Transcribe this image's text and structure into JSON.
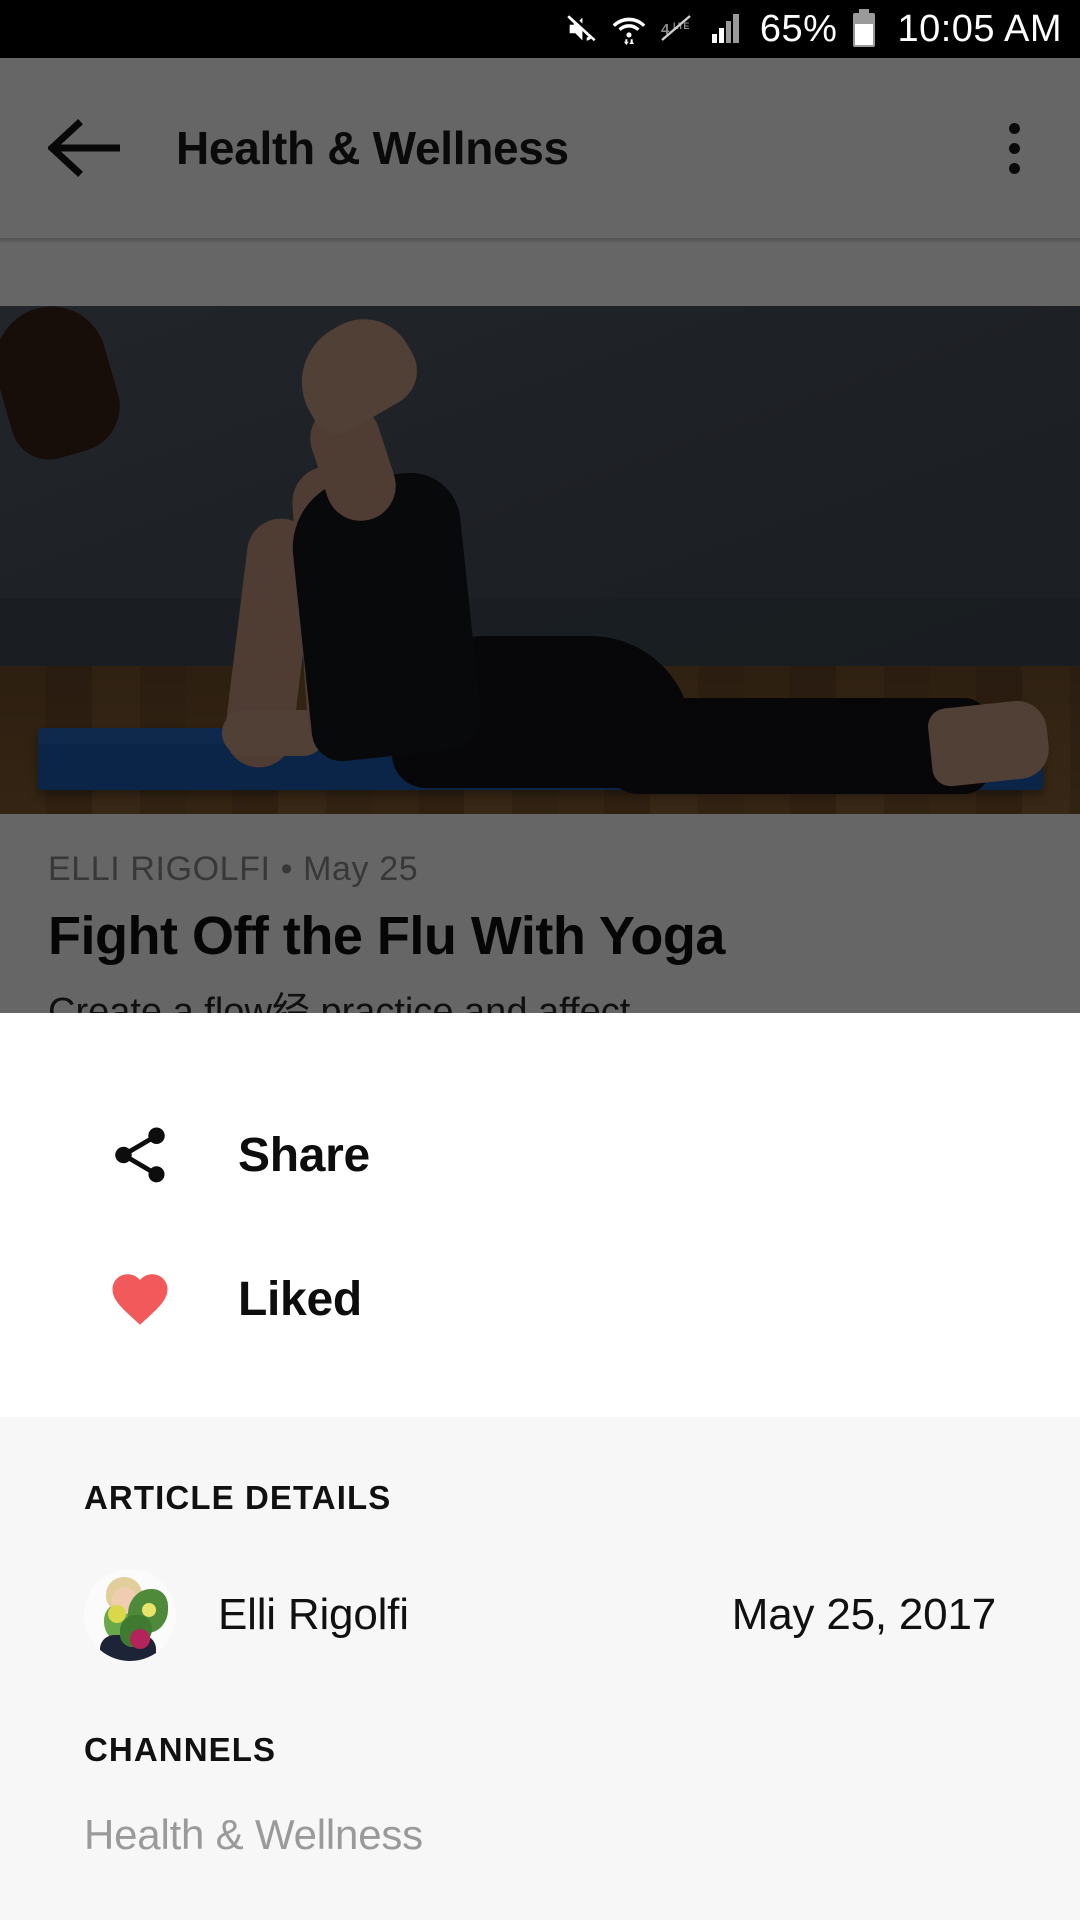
{
  "status_bar": {
    "battery_text": "65%",
    "time": "10:05 AM",
    "icons": [
      "mute-icon",
      "wifi-icon",
      "lte-off-icon",
      "signal-icon",
      "battery-icon"
    ]
  },
  "app_bar": {
    "back_icon": "back-arrow-icon",
    "title": "Health & Wellness",
    "menu_icon": "overflow-menu-icon"
  },
  "article": {
    "author": "ELLI RIGOLFI",
    "bullet": "•",
    "date_short": "May 25",
    "title": "Fight Off the Flu With Yoga",
    "lede": "Create a flow经 practice and affect",
    "hero_alt": "woman-upward-dog-yoga-pose"
  },
  "sheet": {
    "actions": [
      {
        "icon": "share-icon",
        "label": "Share",
        "color": "#0d0d0d"
      },
      {
        "icon": "heart-filled-icon",
        "label": "Liked",
        "color": "#f2595b"
      }
    ],
    "details_heading": "ARTICLE DETAILS",
    "author_name": "Elli Rigolfi",
    "author_avatar": "author-avatar-image",
    "published_date": "May 25, 2017",
    "channels_heading": "CHANNELS",
    "channels": [
      "Health & Wellness"
    ]
  },
  "colors": {
    "accent_heart": "#f2595b",
    "sheet_bg": "#ffffff",
    "details_bg": "#f7f7f7",
    "scrim": "rgba(0,0,0,0.60)",
    "status_bar_bg": "#000000",
    "muted_text": "#9a9a9a"
  }
}
